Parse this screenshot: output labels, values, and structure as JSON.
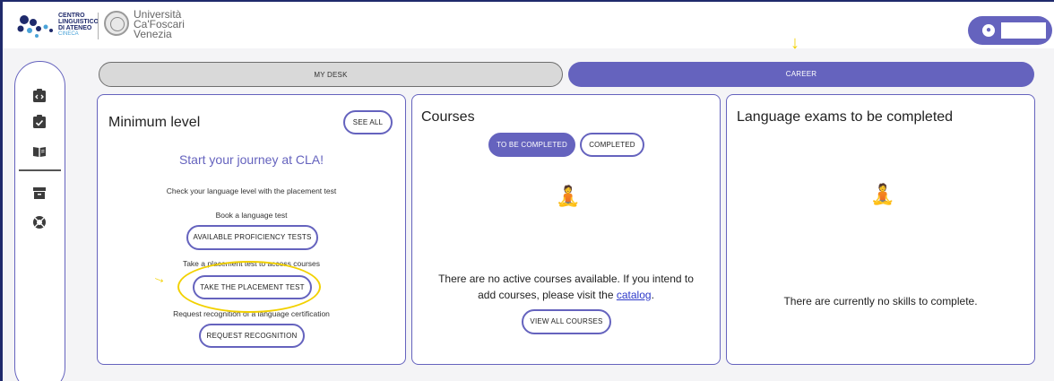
{
  "header": {
    "cla_logo_lines": [
      "CENTRO",
      "LINGUISTICO",
      "DI ATENEO"
    ],
    "cla_sub": "CINECA",
    "university_lines": [
      "Università",
      "Ca'Foscari",
      "Venezia"
    ]
  },
  "tabs": [
    {
      "label": "MY DESK",
      "active": false
    },
    {
      "label": "CAREER",
      "active": true
    }
  ],
  "sidebar": {
    "icons": [
      "code-badge-icon",
      "clipboard-check-icon",
      "book-open-icon",
      "archive-icon",
      "lifebuoy-icon"
    ]
  },
  "minimum_level": {
    "title": "Minimum level",
    "see_all": "SEE ALL",
    "headline": "Start your journey at CLA!",
    "check_text": "Check your language level with the placement test",
    "book_text": "Book a language test",
    "proficiency_button": "AVAILABLE PROFICIENCY TESTS",
    "placement_text": "Take a placement test to access courses",
    "placement_button": "TAKE THE PLACEMENT TEST",
    "recognition_text": "Request recognition of a language certification",
    "recognition_button": "REQUEST RECOGNITION"
  },
  "courses": {
    "title": "Courses",
    "toggle_to_be_completed": "TO BE COMPLETED",
    "toggle_completed": "COMPLETED",
    "empty_text_line1": "There are no active courses available. If you intend to",
    "empty_text_line2_prefix": "add courses, please visit the ",
    "empty_link": "catalog",
    "empty_text_suffix": ".",
    "view_all_button": "VIEW ALL COURSES"
  },
  "exams": {
    "title": "Language exams to be completed",
    "empty_text": "There are currently no skills to complete."
  },
  "colors": {
    "accent": "#6563be",
    "highlight": "#f2d100",
    "link": "#2d39c9"
  }
}
